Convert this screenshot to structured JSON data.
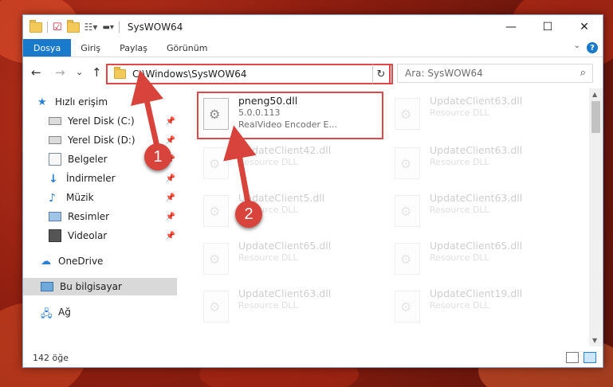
{
  "window": {
    "title": "SysWOW64",
    "controls": {
      "minimize": "—",
      "maximize": "☐",
      "close": "✕"
    }
  },
  "ribbon": {
    "tabs": [
      "Dosya",
      "Giriş",
      "Paylaş",
      "Görünüm"
    ],
    "help_label": "?"
  },
  "nav": {
    "back": "←",
    "forward": "→",
    "recent": "⌄",
    "up": "↑",
    "address": "C:\\Windows\\SysWOW64",
    "refresh": "↻",
    "search_placeholder": "Ara: SysWOW64"
  },
  "sidebar": {
    "items": [
      {
        "label": "Hızlı erişim",
        "icon": "star-icon",
        "pinned": false
      },
      {
        "label": "Yerel Disk (C:)",
        "icon": "drive-icon",
        "pinned": true
      },
      {
        "label": "Yerel Disk (D:)",
        "icon": "drive-icon",
        "pinned": true
      },
      {
        "label": "Belgeler",
        "icon": "documents-icon",
        "pinned": true
      },
      {
        "label": "İndirmeler",
        "icon": "download-icon",
        "pinned": true
      },
      {
        "label": "Müzik",
        "icon": "music-icon",
        "pinned": true
      },
      {
        "label": "Resimler",
        "icon": "pictures-icon",
        "pinned": true
      },
      {
        "label": "Videolar",
        "icon": "videos-icon",
        "pinned": true
      },
      {
        "label": "OneDrive",
        "icon": "cloud-icon",
        "pinned": false
      },
      {
        "label": "Bu bilgisayar",
        "icon": "computer-icon",
        "pinned": false,
        "selected": true
      },
      {
        "label": "Ağ",
        "icon": "network-icon",
        "pinned": false
      }
    ]
  },
  "files": {
    "highlighted": {
      "name": "pneng50.dll",
      "version": "5.0.0.113",
      "desc": "RealVideo Encoder E..."
    },
    "faded": [
      {
        "name": "UpdateClient63.dll",
        "type": "Resource DLL"
      },
      {
        "name": "UpdateClient42.dll",
        "type": "Resource DLL"
      },
      {
        "name": "UpdateClient63.dll",
        "type": "Resource DLL"
      },
      {
        "name": "UpdateClient5.dll",
        "type": "Resource DLL"
      },
      {
        "name": "UpdateClient63.dll",
        "type": "Resource DLL"
      },
      {
        "name": "UpdateClient65.dll",
        "type": "Resource DLL"
      },
      {
        "name": "UpdateClient65.dll",
        "type": "Resource DLL"
      },
      {
        "name": "UpdateClient63.dll",
        "type": "Resource DLL"
      },
      {
        "name": "UpdateClient19.dll",
        "type": "Resource DLL"
      }
    ]
  },
  "status": {
    "count": "142 öğe"
  },
  "callouts": [
    "1",
    "2"
  ],
  "colors": {
    "accent": "#1979ca",
    "callout": "#d8443c",
    "highlight_border": "#e04848"
  }
}
